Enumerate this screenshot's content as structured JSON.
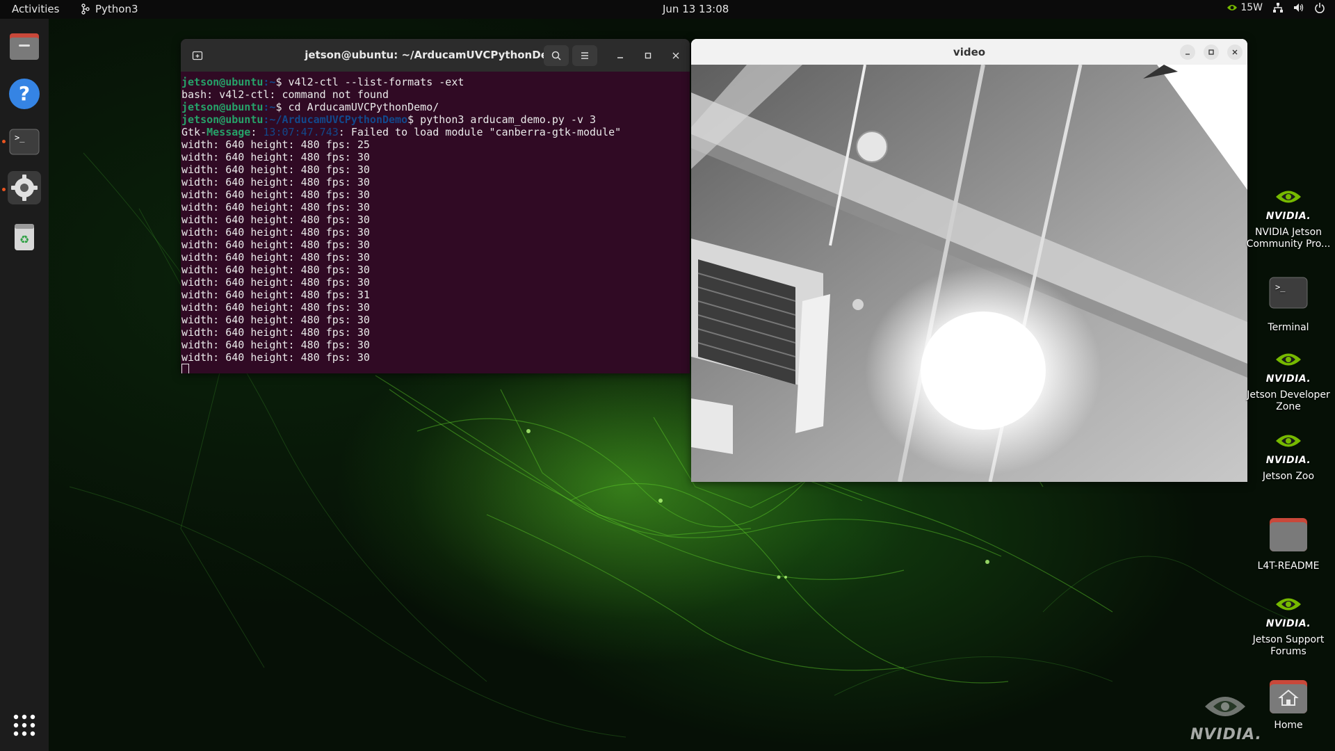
{
  "topbar": {
    "activities": "Activities",
    "app_name": "Python3",
    "clock": "Jun 13  13:08",
    "power_mode": "15W"
  },
  "dock": {
    "items": [
      "files-icon",
      "help-icon",
      "terminal-icon",
      "settings-icon",
      "trash-icon",
      "app-grid-icon"
    ]
  },
  "terminal": {
    "title": "jetson@ubuntu: ~/ArducamUVCPythonDemo",
    "lines": {
      "l1_user": "jetson@ubuntu",
      "l1_path": ":~",
      "l1_cmd": "$ v4l2-ctl --list-formats -ext",
      "l2": "bash: v4l2-ctl: command not found",
      "l3_user": "jetson@ubuntu",
      "l3_path": ":~",
      "l3_cmd": "$ cd ArducamUVCPythonDemo/",
      "l4_user": "jetson@ubuntu",
      "l4_path": ":~/ArducamUVCPythonDemo",
      "l4_cmd": "$ python3 arducam_demo.py -v 3",
      "gtk_prefix": "Gtk-",
      "gtk_level": "Message",
      "gtk_colon": ": ",
      "gtk_time": "13:07:47.743",
      "gtk_msg": ": Failed to load module \"canberra-gtk-module\"",
      "fps_lines": [
        "width: 640 height: 480 fps: 25",
        "width: 640 height: 480 fps: 30",
        "width: 640 height: 480 fps: 30",
        "width: 640 height: 480 fps: 30",
        "width: 640 height: 480 fps: 30",
        "width: 640 height: 480 fps: 30",
        "width: 640 height: 480 fps: 30",
        "width: 640 height: 480 fps: 30",
        "width: 640 height: 480 fps: 30",
        "width: 640 height: 480 fps: 30",
        "width: 640 height: 480 fps: 30",
        "width: 640 height: 480 fps: 30",
        "width: 640 height: 480 fps: 31",
        "width: 640 height: 480 fps: 30",
        "width: 640 height: 480 fps: 30",
        "width: 640 height: 480 fps: 30",
        "width: 640 height: 480 fps: 30",
        "width: 640 height: 480 fps: 30"
      ]
    }
  },
  "video": {
    "title": "video"
  },
  "desktop_icons": [
    {
      "label": "NVIDIA Jetson Community Pro...",
      "logo_text": "NVIDIA."
    },
    {
      "label": "Terminal"
    },
    {
      "label": "Jetson Developer Zone",
      "logo_text": "NVIDIA."
    },
    {
      "label": "Jetson Zoo",
      "logo_text": "NVIDIA."
    },
    {
      "label": "L4T-README"
    },
    {
      "label": "Jetson Support Forums",
      "logo_text": "NVIDIA."
    },
    {
      "label": "Home"
    }
  ],
  "watermark": "NVIDIA.",
  "colors": {
    "terminal_bg": "#300a24",
    "prompt_green": "#26a269",
    "prompt_blue": "#12488b",
    "accent": "#e95420",
    "nvidia_green": "#76b900"
  }
}
